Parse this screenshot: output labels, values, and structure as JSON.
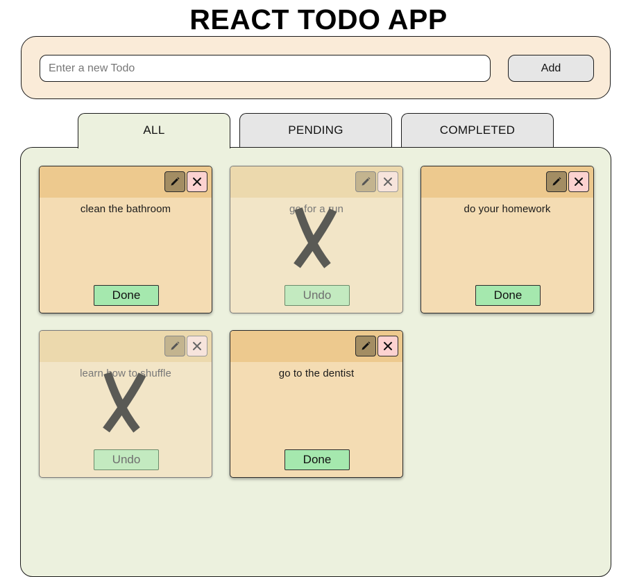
{
  "app": {
    "title": "REACT TODO APP"
  },
  "input": {
    "placeholder": "Enter a new Todo",
    "value": ""
  },
  "add_button": {
    "label": "Add"
  },
  "tabs": [
    {
      "label": "ALL",
      "active": true
    },
    {
      "label": "PENDING",
      "active": false
    },
    {
      "label": "COMPLETED",
      "active": false
    }
  ],
  "todos": [
    {
      "text": "clean the bathroom",
      "completed": false,
      "action_label": "Done"
    },
    {
      "text": "go for a run",
      "completed": true,
      "action_label": "Undo"
    },
    {
      "text": "do your homework",
      "completed": false,
      "action_label": "Done"
    },
    {
      "text": "learn how to shuffle",
      "completed": true,
      "action_label": "Undo"
    },
    {
      "text": "go to the dentist",
      "completed": false,
      "action_label": "Done"
    }
  ],
  "icons": {
    "edit": "pencil-icon",
    "delete": "close-icon",
    "completed_mark": "strike-x-icon"
  },
  "colors": {
    "input_panel_bg": "#faebd8",
    "list_panel_bg": "#ecf1de",
    "card_bg": "#f4dcb3",
    "card_header_bg": "#edc98e",
    "done_button_bg": "#a5e8ae",
    "delete_button_bg": "#fcd2d0",
    "edit_button_bg": "#a38d63"
  }
}
